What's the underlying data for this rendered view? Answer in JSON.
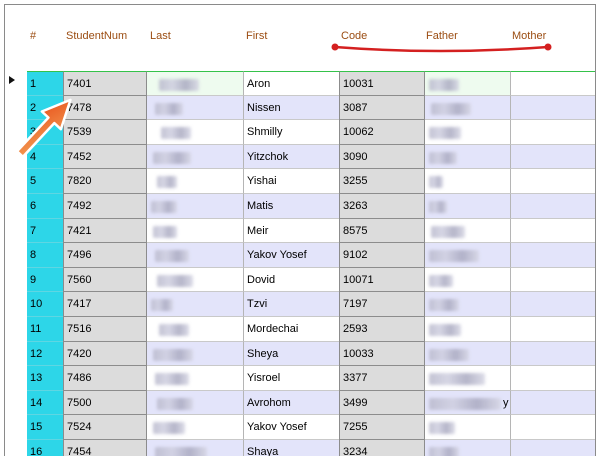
{
  "columns": {
    "num": "#",
    "student": "StudentNum",
    "last": "Last",
    "first": "First",
    "code": "Code",
    "father": "Father",
    "mother": "Mother"
  },
  "rows": [
    {
      "num": "1",
      "student": "7401",
      "first": "Aron",
      "code": "10031"
    },
    {
      "num": "2",
      "student": "7478",
      "first": "Nissen",
      "code": "3087"
    },
    {
      "num": "3",
      "student": "7539",
      "first": "Shmilly",
      "code": "10062"
    },
    {
      "num": "4",
      "student": "7452",
      "first": "Yitzchok",
      "code": "3090"
    },
    {
      "num": "5",
      "student": "7820",
      "first": "Yishai",
      "code": "3255"
    },
    {
      "num": "6",
      "student": "7492",
      "first": "Matis",
      "code": "3263"
    },
    {
      "num": "7",
      "student": "7421",
      "first": "Meir",
      "code": "8575"
    },
    {
      "num": "8",
      "student": "7496",
      "first": "Yakov Yosef",
      "code": "9102"
    },
    {
      "num": "9",
      "student": "7560",
      "first": "Dovid",
      "code": "10071"
    },
    {
      "num": "10",
      "student": "7417",
      "first": "Tzvi",
      "code": "7197"
    },
    {
      "num": "11",
      "student": "7516",
      "first": "Mordechai",
      "code": "2593"
    },
    {
      "num": "12",
      "student": "7420",
      "first": "Sheya",
      "code": "10033"
    },
    {
      "num": "13",
      "student": "7486",
      "first": "Yisroel",
      "code": "3377"
    },
    {
      "num": "14",
      "student": "7500",
      "first": "Avrohom",
      "code": "3499",
      "father_tail": "y"
    },
    {
      "num": "15",
      "student": "7524",
      "first": "Yakov Yosef",
      "code": "7255"
    },
    {
      "num": "16",
      "student": "7454",
      "first": "Shaya",
      "code": "3234"
    }
  ],
  "colors": {
    "header_text": "#9b4d12",
    "row_number_bg": "#2dd6e8",
    "readonly_bg": "#dcdcdc",
    "alt_row_bg": "#e3e4fa",
    "annotation_red": "#d42020",
    "annotation_arrow": "#f06a1a",
    "selection_border": "#35c24a"
  },
  "icons": {
    "row_pointer": "triangle-right",
    "annotation_arrow": "arrow-up-left",
    "annotation_line": "underline-with-dots"
  },
  "selected_row": 1
}
